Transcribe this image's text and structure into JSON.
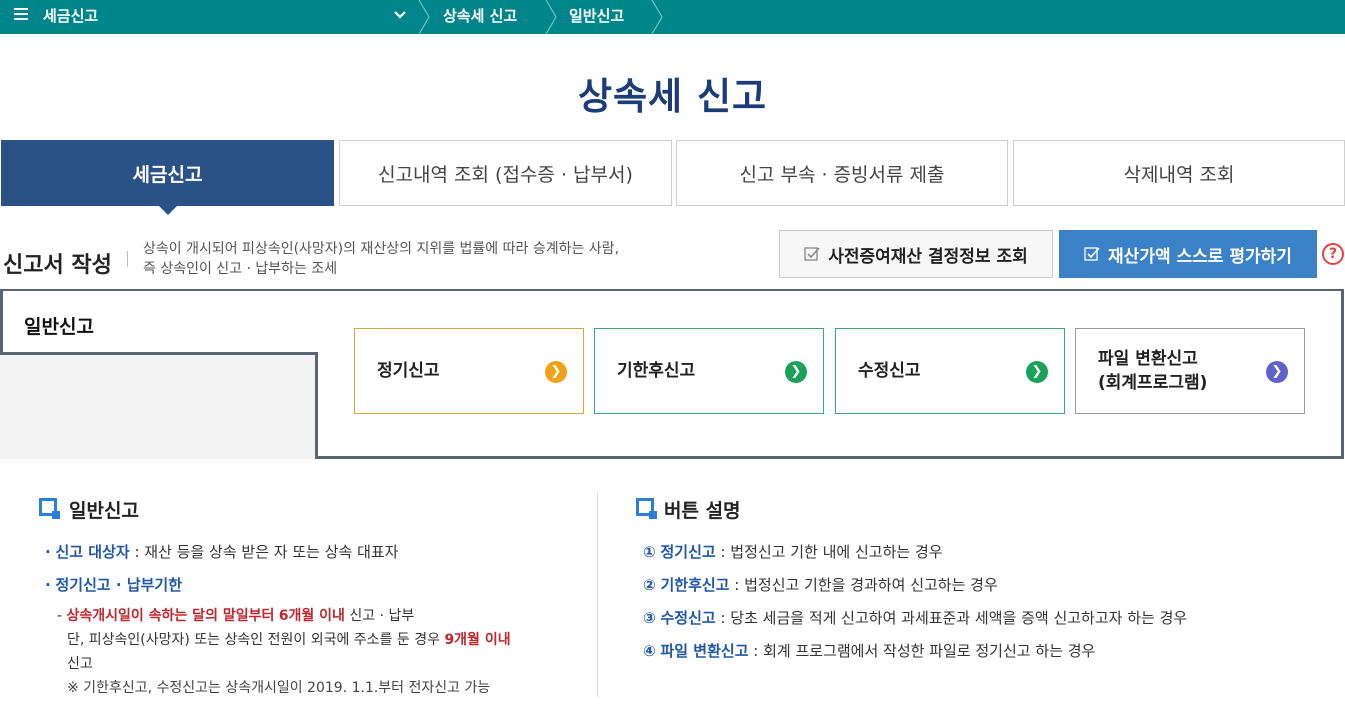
{
  "topbar": {
    "menu_label": "세금신고",
    "breadcrumb": [
      "상속세 신고",
      "일반신고"
    ]
  },
  "page_title": "상속세 신고",
  "tabs": [
    {
      "label": "세금신고",
      "active": true
    },
    {
      "label": "신고내역 조회 (접수증 · 납부서)",
      "active": false
    },
    {
      "label": "신고 부속 · 증빙서류 제출",
      "active": false
    },
    {
      "label": "삭제내역 조회",
      "active": false
    }
  ],
  "section": {
    "title": "신고서 작성",
    "desc_line1": "상속이 개시되어 피상속인(사망자)의 재산상의 지위를 법률에 따라 승계하는 사람,",
    "desc_line2": "즉 상속인이 신고 · 납부하는 조세"
  },
  "buttons": {
    "lookup": "사전증여재산 결정정보 조회",
    "evaluate": "재산가액 스스로 평가하기",
    "help": "?"
  },
  "general": {
    "label": "일반신고",
    "cards": [
      {
        "label": "정기신고",
        "border": "#d6a83a",
        "arrow_color": "#f0a21a"
      },
      {
        "label": "기한후신고",
        "border": "#3aa87a",
        "arrow_color": "#1aa25a"
      },
      {
        "label": "수정신고",
        "border": "#3aa87a",
        "arrow_color": "#1aa25a"
      },
      {
        "label_line1": "파일 변환신고",
        "label_line2": "(회계프로그램)",
        "border": "#9a9a9a",
        "arrow_color": "#5f63c9"
      }
    ]
  },
  "info_left": {
    "heading": "일반신고",
    "item1_label": "신고 대상자",
    "item1_text": " : 재산 등을 상속 받은 자 또는 상속 대표자",
    "item2_label": "정기신고 · 납부기한",
    "sub1_red1": "상속개시일이 속하는 달의 말일부터",
    "sub1_red2": "6개월 이내",
    "sub1_text": " 신고 · 납부",
    "sub2_text": "단, 피상속인(사망자) 또는 상속인 전원이 외국에 주소를 둔 경우",
    "sub2_red": "9개월 이내",
    "sub3_text": "신고",
    "note": "※ 기한후신고, 수정신고는 상속개시일이 2019. 1.1.부터 전자신고 가능"
  },
  "info_right": {
    "heading": "버튼 설명",
    "items": [
      {
        "num": "①",
        "label": "정기신고",
        "text": " : 법정신고 기한 내에 신고하는 경우"
      },
      {
        "num": "②",
        "label": "기한후신고",
        "text": " : 법정신고 기한을 경과하여 신고하는 경우"
      },
      {
        "num": "③",
        "label": "수정신고",
        "text": " : 당초 세금을 적게 신고하여 과세표준과 세액을 증액 신고하고자 하는 경우"
      },
      {
        "num": "④",
        "label": "파일 변환신고",
        "text": " : 회계 프로그램에서 작성한 파일로 정기신고 하는 경우"
      }
    ]
  }
}
